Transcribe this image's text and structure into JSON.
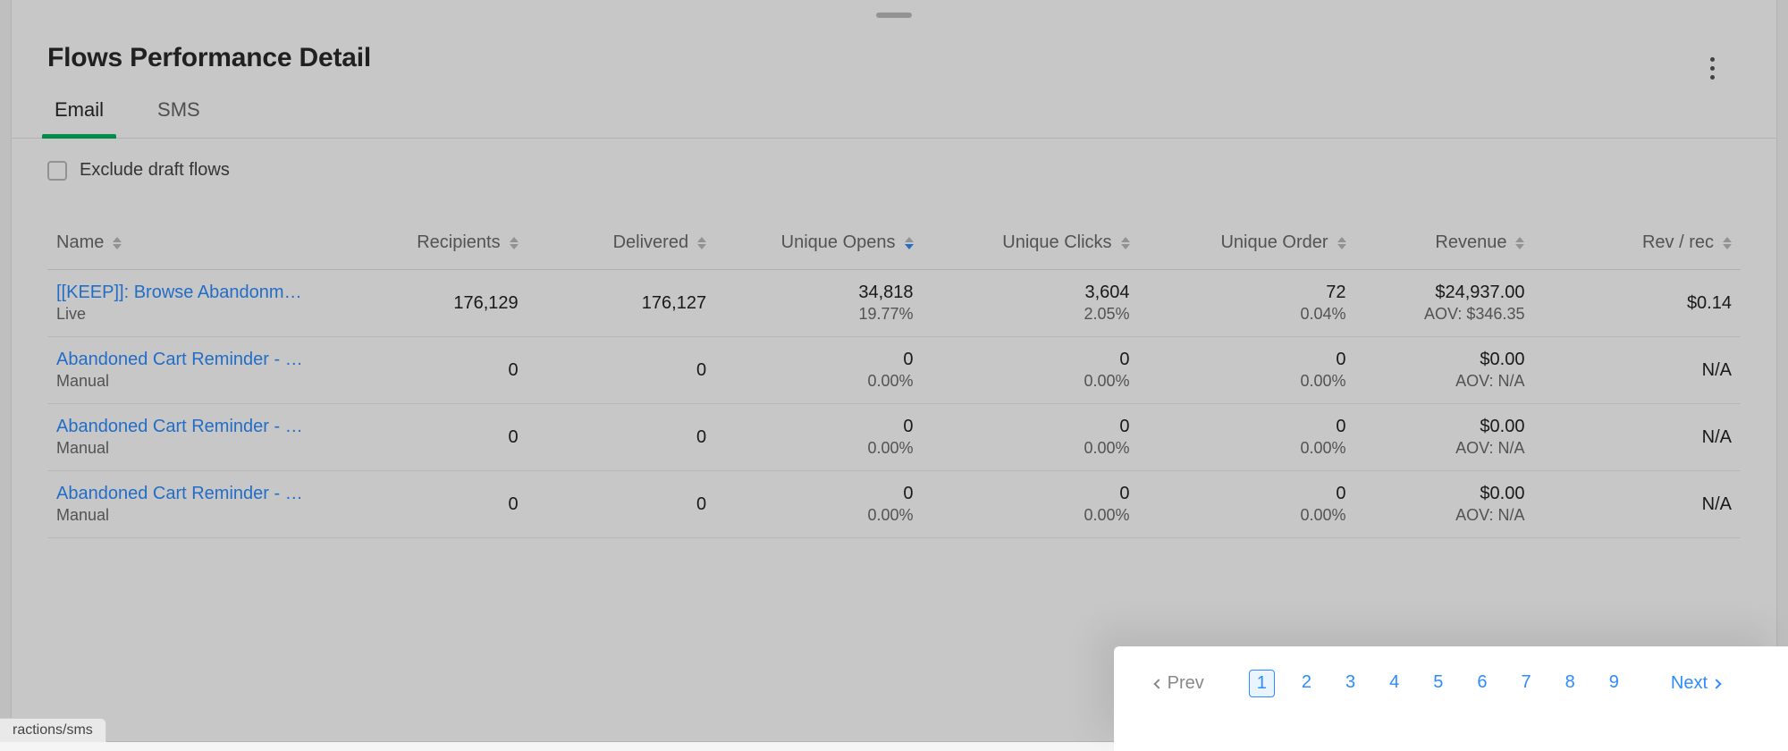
{
  "title": "Flows Performance Detail",
  "tabs": {
    "email": "Email",
    "sms": "SMS"
  },
  "filter": {
    "exclude_draft_label": "Exclude draft flows"
  },
  "columns": {
    "name": "Name",
    "recipients": "Recipients",
    "delivered": "Delivered",
    "unique_opens": "Unique Opens",
    "unique_clicks": "Unique Clicks",
    "unique_order": "Unique Order",
    "revenue": "Revenue",
    "rev_per_rec": "Rev / rec"
  },
  "rows": [
    {
      "name": "[[KEEP]]: Browse Abandonm…",
      "status": "Live",
      "recipients": "176,129",
      "delivered": "176,127",
      "opens": "34,818",
      "opens_pct": "19.77%",
      "clicks": "3,604",
      "clicks_pct": "2.05%",
      "orders": "72",
      "orders_pct": "0.04%",
      "revenue": "$24,937.00",
      "aov": "AOV: $346.35",
      "rev_rec": "$0.14"
    },
    {
      "name": "Abandoned Cart Reminder - …",
      "status": "Manual",
      "recipients": "0",
      "delivered": "0",
      "opens": "0",
      "opens_pct": "0.00%",
      "clicks": "0",
      "clicks_pct": "0.00%",
      "orders": "0",
      "orders_pct": "0.00%",
      "revenue": "$0.00",
      "aov": "AOV: N/A",
      "rev_rec": "N/A"
    },
    {
      "name": "Abandoned Cart Reminder - …",
      "status": "Manual",
      "recipients": "0",
      "delivered": "0",
      "opens": "0",
      "opens_pct": "0.00%",
      "clicks": "0",
      "clicks_pct": "0.00%",
      "orders": "0",
      "orders_pct": "0.00%",
      "revenue": "$0.00",
      "aov": "AOV: N/A",
      "rev_rec": "N/A"
    },
    {
      "name": "Abandoned Cart Reminder - …",
      "status": "Manual",
      "recipients": "0",
      "delivered": "0",
      "opens": "0",
      "opens_pct": "0.00%",
      "clicks": "0",
      "clicks_pct": "0.00%",
      "orders": "0",
      "orders_pct": "0.00%",
      "revenue": "$0.00",
      "aov": "AOV: N/A",
      "rev_rec": "N/A"
    }
  ],
  "pagination": {
    "prev": "Prev",
    "next": "Next",
    "pages": [
      "1",
      "2",
      "3",
      "4",
      "5",
      "6",
      "7",
      "8",
      "9"
    ],
    "active": "1"
  },
  "status_url": "ractions/sms"
}
